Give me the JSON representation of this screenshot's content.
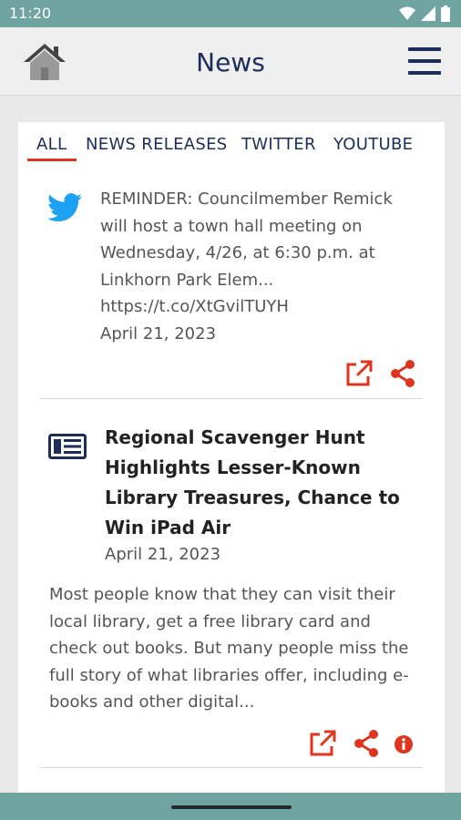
{
  "status_bar": {
    "time": "11:20"
  },
  "app_bar": {
    "title": "News"
  },
  "tabs": [
    {
      "label": "ALL"
    },
    {
      "label": "NEWS RELEASES"
    },
    {
      "label": "TWITTER"
    },
    {
      "label": "YOUTUBE"
    }
  ],
  "tweet": {
    "lines": [
      "REMINDER: Councilmember Remick",
      "will host a town hall meeting on",
      "Wednesday, 4/26, at 6:30 p.m. at",
      "Linkhorn Park Elem...",
      "https://t.co/XtGvilTUYH"
    ],
    "date": "April 21, 2023"
  },
  "news_release": {
    "title_lines": [
      "Regional Scavenger Hunt",
      "Highlights Lesser-Known",
      "Library Treasures, Chance to",
      "Win iPad Air"
    ],
    "date": "April 21, 2023",
    "summary_lines": [
      "Most people know that they can visit their",
      "local library, get a free library card and",
      "check out books. But many people miss the",
      "full story of what libraries offer, including e-",
      "books and other digital..."
    ]
  },
  "colors": {
    "accent": "#e1341e",
    "navy": "#1c2d5c",
    "status_bar": "#6fa4a0",
    "twitter": "#1da1f2"
  }
}
